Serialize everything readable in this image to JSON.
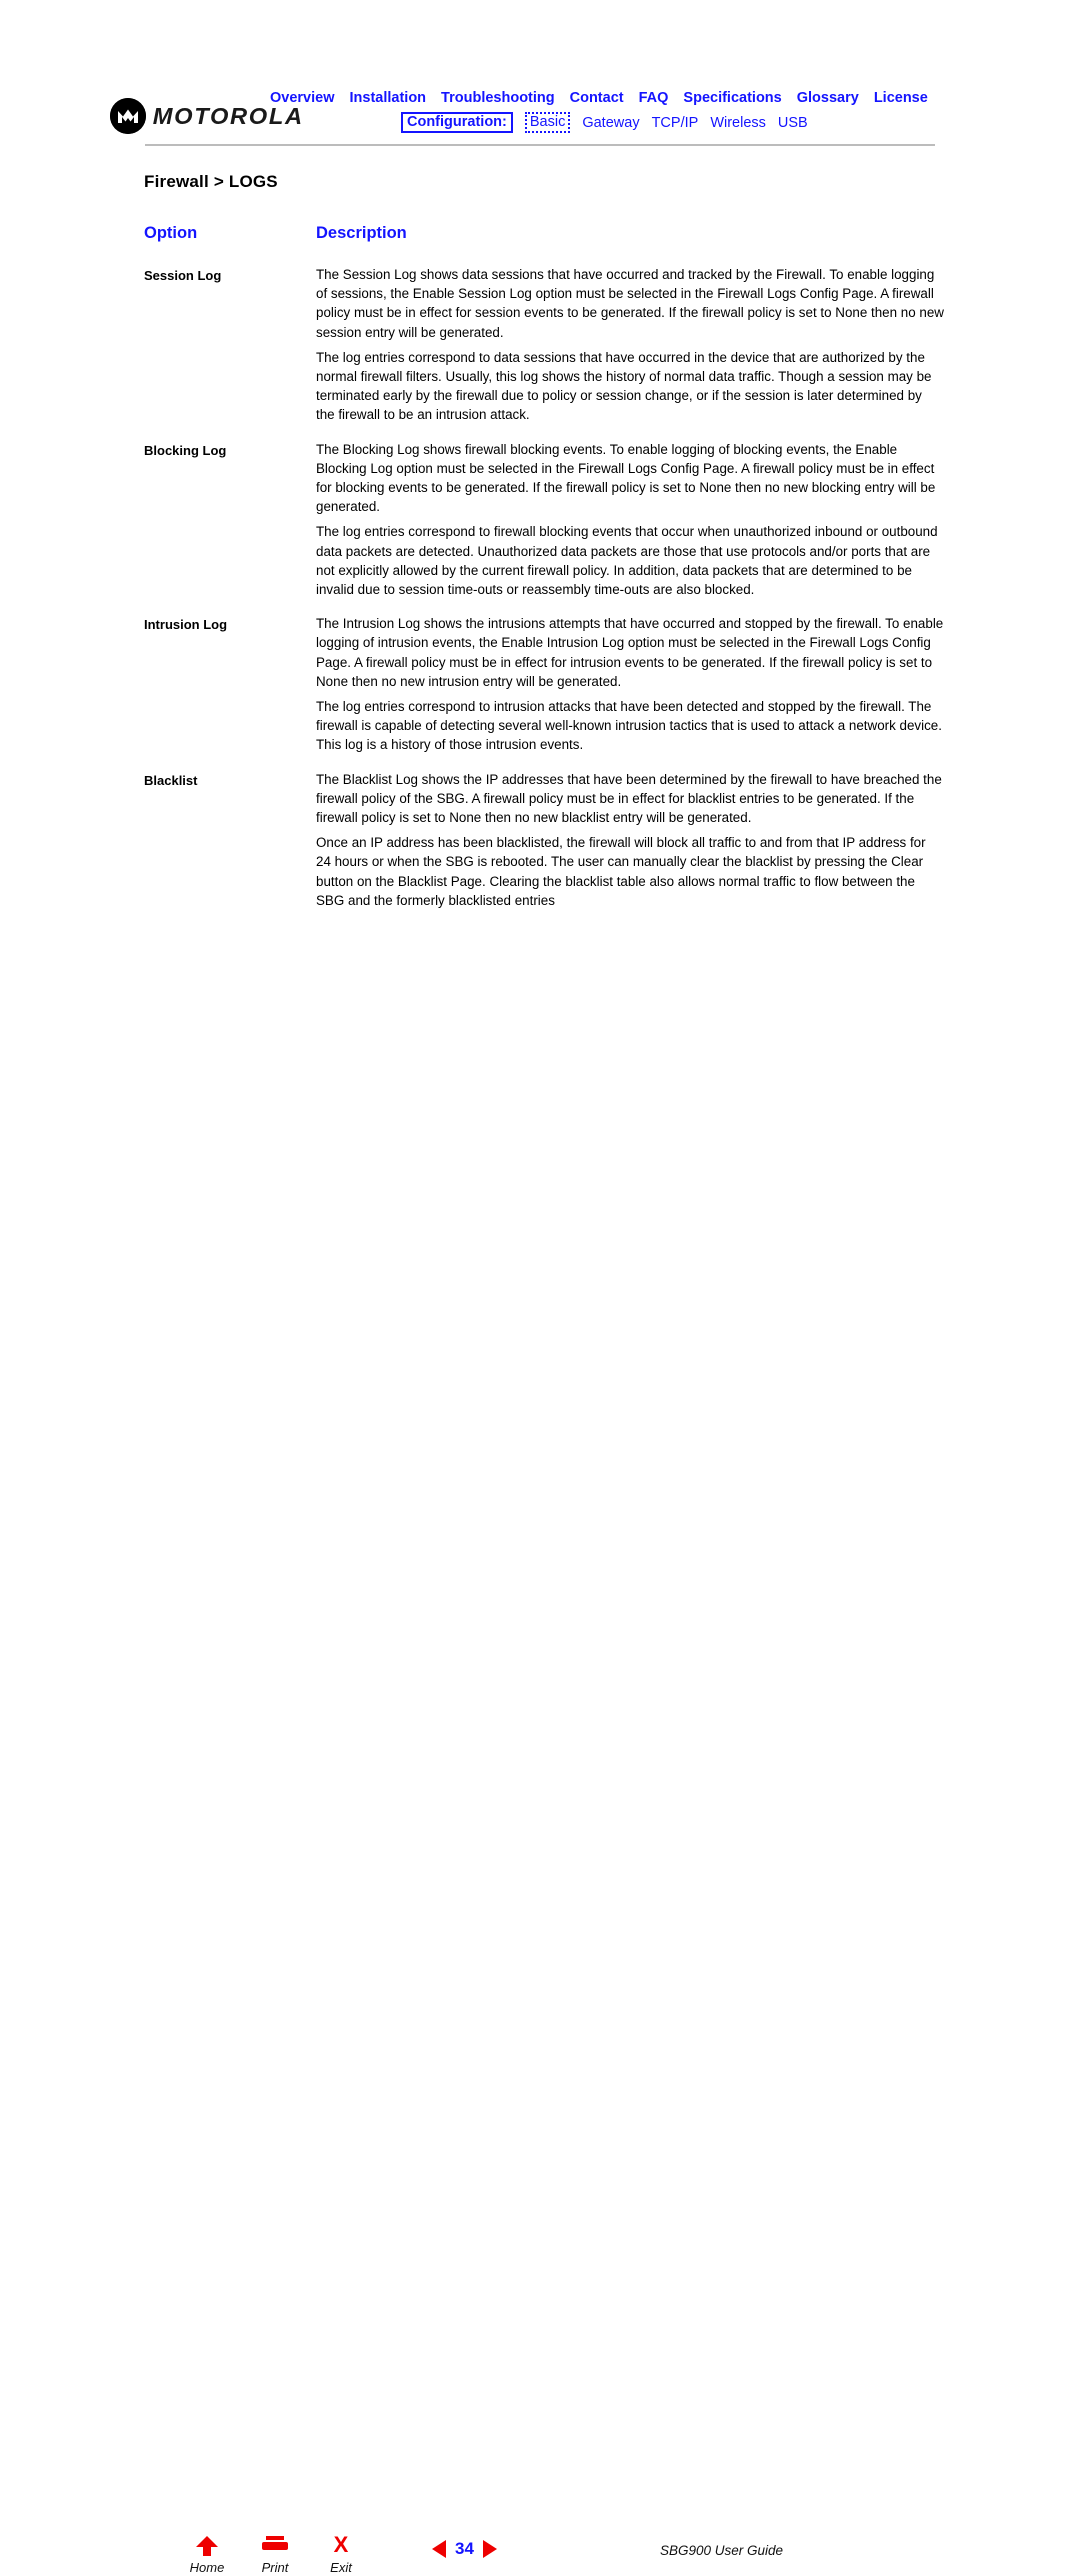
{
  "brand": {
    "logo_wordmark": "MOTOROLA",
    "logo_icon": "motorola-batwing-icon"
  },
  "nav": {
    "primary": [
      {
        "label": "Overview"
      },
      {
        "label": "Installation"
      },
      {
        "label": "Troubleshooting"
      },
      {
        "label": "Contact"
      },
      {
        "label": "FAQ"
      },
      {
        "label": "Specifications"
      },
      {
        "label": "Glossary"
      },
      {
        "label": "License"
      }
    ],
    "config_label": "Configuration:",
    "secondary": [
      {
        "label": "Basic",
        "focused": true
      },
      {
        "label": "Gateway",
        "focused": false
      },
      {
        "label": "TCP/IP",
        "focused": false
      },
      {
        "label": "Wireless",
        "focused": false
      },
      {
        "label": "USB",
        "focused": false
      }
    ]
  },
  "page": {
    "title": "Firewall > LOGS"
  },
  "table": {
    "headers": {
      "option": "Option",
      "description": "Description"
    },
    "rows": [
      {
        "option": "Session Log",
        "paragraphs": [
          "The Session Log shows data sessions that have occurred and tracked by the Firewall. To enable logging of sessions, the Enable Session Log option must be selected in the Firewall Logs Config Page. A firewall policy must be in effect for session events to be generated. If the firewall policy is set to None then no new session entry will be generated.",
          "The log entries correspond to data sessions that have occurred in the device that are authorized by the normal firewall filters. Usually, this log shows the history of normal data traffic. Though a session may be terminated early by the firewall due to policy or session change, or if the session is later determined by the firewall to be an intrusion attack."
        ]
      },
      {
        "option": "Blocking Log",
        "paragraphs": [
          "The Blocking Log shows firewall blocking events. To enable logging of blocking events, the Enable Blocking Log option must be selected in the Firewall Logs Config Page. A firewall policy must be in effect for blocking events to be generated. If the firewall policy is set to None then no new blocking entry will be generated.",
          "The log entries correspond to firewall blocking events that occur when unauthorized inbound or outbound data packets are detected. Unauthorized data packets are those that use protocols and/or ports that are not explicitly allowed by the current firewall policy. In addition, data packets that are determined to be invalid due to session time-outs or reassembly time-outs are also blocked."
        ]
      },
      {
        "option": "Intrusion Log",
        "paragraphs": [
          "The Intrusion Log shows the intrusions attempts that have occurred and stopped by the firewall. To enable logging of intrusion events, the Enable Intrusion Log option must be selected in the Firewall Logs Config Page. A firewall policy must be in effect for intrusion events to be generated. If the firewall policy is set to None then no new intrusion entry will be generated.",
          "The log entries correspond to intrusion attacks that have been detected and stopped by the firewall. The firewall is capable of detecting several well-known intrusion tactics that is used to attack a network device. This log is a history of those intrusion events."
        ]
      },
      {
        "option": "Blacklist",
        "paragraphs": [
          "The Blacklist Log shows the IP addresses that have been determined by the firewall to have breached the firewall policy of the SBG. A firewall policy must be in effect for blacklist entries to be generated. If the firewall policy is set to None then no new blacklist entry will be generated.",
          "Once an IP address has been blacklisted, the firewall will block all traffic to and from that IP address for 24 hours or when the SBG is rebooted. The user can manually clear the blacklist by pressing the Clear button on the Blacklist Page. Clearing the blacklist table also allows normal traffic to flow between the SBG and the formerly blacklisted entries"
        ]
      }
    ]
  },
  "footer": {
    "home_label": "Home",
    "print_label": "Print",
    "exit_label": "Exit",
    "exit_glyph": "X",
    "page_number": "34",
    "guide_name": "SBG900 User Guide"
  },
  "colors": {
    "link_blue": "#1414ff",
    "accent_red": "#ee0000",
    "rule_gray": "#bcbcbc"
  }
}
